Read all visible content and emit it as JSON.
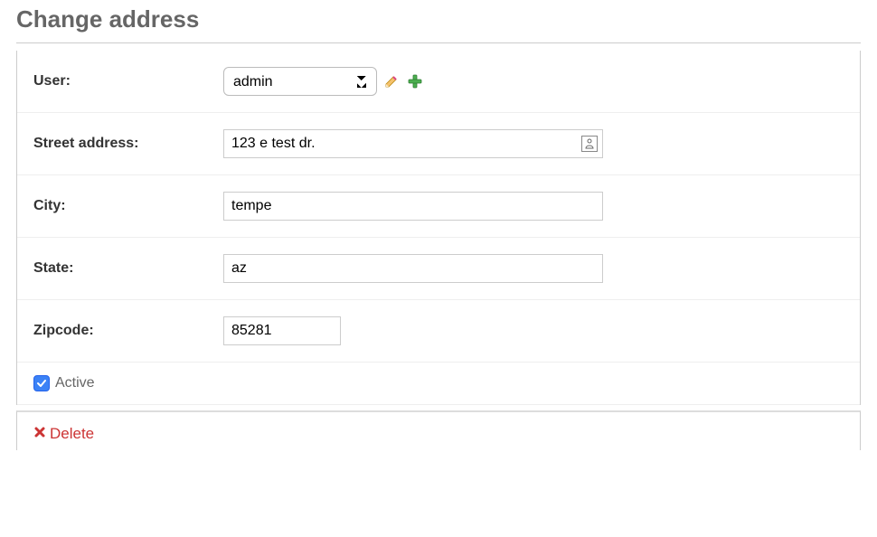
{
  "page": {
    "title": "Change address"
  },
  "form": {
    "user": {
      "label": "User:",
      "value": "admin"
    },
    "street": {
      "label": "Street address:",
      "value": "123 e test dr."
    },
    "city": {
      "label": "City:",
      "value": "tempe"
    },
    "state": {
      "label": "State:",
      "value": "az"
    },
    "zipcode": {
      "label": "Zipcode:",
      "value": "85281"
    },
    "active": {
      "label": "Active",
      "checked": true
    }
  },
  "actions": {
    "delete": "Delete"
  }
}
